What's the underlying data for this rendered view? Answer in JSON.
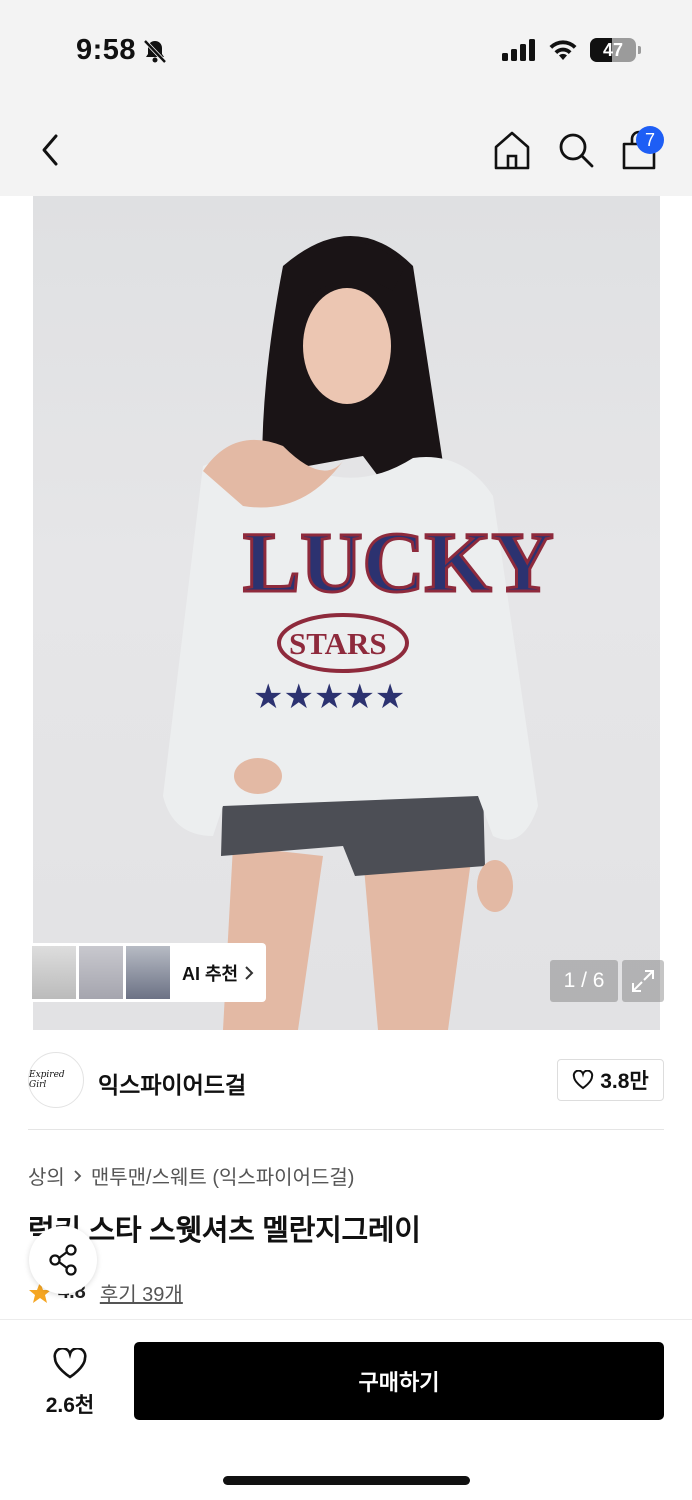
{
  "status": {
    "time": "9:58",
    "battery": "47"
  },
  "nav": {
    "cart_badge": "7"
  },
  "gallery": {
    "counter": "1 / 6",
    "ai_label": "AI 추천"
  },
  "brand": {
    "logo_text": "Expired Girl",
    "name": "익스파이어드걸",
    "likes": "3.8만"
  },
  "breadcrumb": {
    "root": "상의",
    "leaf": "맨투맨/스웨트 (익스파이어드걸)"
  },
  "product": {
    "title": "럭키 스타 스웻셔츠 멜란지그레이",
    "rating": "4.8",
    "reviews": "후기 39개"
  },
  "bottom_bar": {
    "wish_count": "2.6천",
    "buy_label": "구매하기"
  },
  "colors": {
    "accent": "#1e5ef5",
    "star": "#f5a623",
    "buy": "#000000",
    "print_navy": "#2c3270",
    "print_red": "#8e2a3c"
  }
}
